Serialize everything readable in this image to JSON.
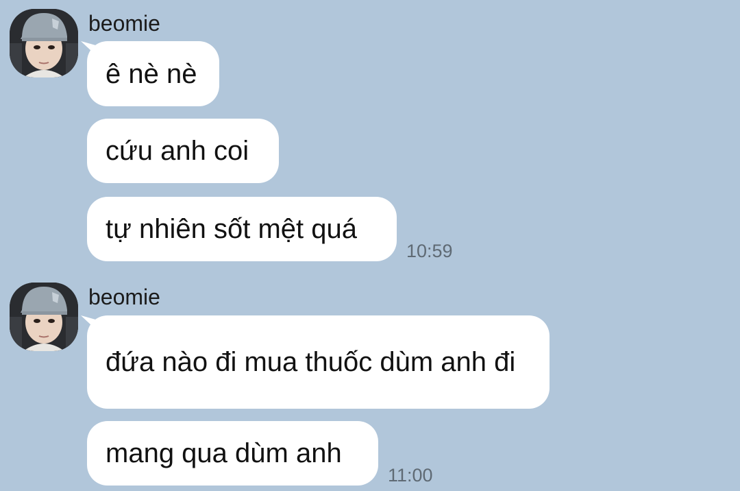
{
  "colors": {
    "background": "#b1c6da",
    "bubble": "#ffffff",
    "timestamp": "#5f6a74"
  },
  "groups": [
    {
      "sender": "beomie",
      "avatar": "profile-photo",
      "messages": [
        "ê nè nè",
        "cứu anh coi",
        "tự nhiên sốt mệt quá"
      ],
      "time": "10:59"
    },
    {
      "sender": "beomie",
      "avatar": "profile-photo",
      "messages": [
        "đứa nào đi mua thuốc dùm anh đi",
        "mang qua dùm anh"
      ],
      "time": "11:00"
    }
  ]
}
